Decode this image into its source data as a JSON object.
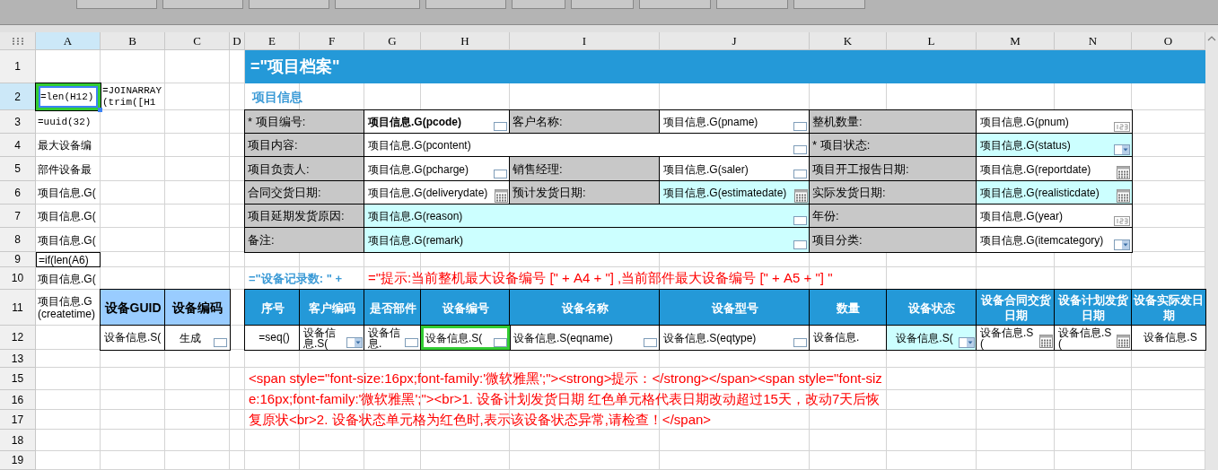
{
  "column_headers": [
    {
      "label": "A",
      "selected": true
    },
    {
      "label": "B",
      "selected": false
    },
    {
      "label": "C",
      "selected": false
    },
    {
      "label": "D",
      "selected": false
    },
    {
      "label": "E",
      "selected": false
    },
    {
      "label": "F",
      "selected": false
    },
    {
      "label": "G",
      "selected": false
    },
    {
      "label": "H",
      "selected": false
    },
    {
      "label": "I",
      "selected": false
    },
    {
      "label": "J",
      "selected": false
    },
    {
      "label": "K",
      "selected": false
    },
    {
      "label": "L",
      "selected": false
    },
    {
      "label": "M",
      "selected": false
    },
    {
      "label": "N",
      "selected": false
    },
    {
      "label": "O",
      "selected": false
    }
  ],
  "row_headers": [
    {
      "label": "1",
      "selected": false
    },
    {
      "label": "2",
      "selected": true
    },
    {
      "label": "3",
      "selected": false
    },
    {
      "label": "4",
      "selected": false
    },
    {
      "label": "5",
      "selected": false
    },
    {
      "label": "6",
      "selected": false
    },
    {
      "label": "7",
      "selected": false
    },
    {
      "label": "8",
      "selected": false
    },
    {
      "label": "9",
      "selected": false
    },
    {
      "label": "10",
      "selected": false
    },
    {
      "label": "11",
      "selected": false
    },
    {
      "label": "12",
      "selected": false
    },
    {
      "label": "13",
      "selected": false
    },
    {
      "label": "15",
      "selected": false
    },
    {
      "label": "16",
      "selected": false
    },
    {
      "label": "17",
      "selected": false
    },
    {
      "label": "18",
      "selected": false
    },
    {
      "label": "19",
      "selected": false
    }
  ],
  "cells": [
    {
      "kind": "title",
      "text": "=\"项目档案\""
    },
    {
      "kind": "formula",
      "text": "=len(H12)",
      "selected": true
    },
    {
      "kind": "formula",
      "text": "=JOINARRAY(trim([H1"
    },
    {
      "kind": "section",
      "text": "项目信息"
    },
    {
      "kind": "formula",
      "text": "=uuid(32)"
    },
    {
      "kind": "text",
      "text": "最大设备编"
    },
    {
      "kind": "text",
      "text": "部件设备最"
    },
    {
      "kind": "text",
      "text": "项目信息.G("
    },
    {
      "kind": "text",
      "text": "项目信息.G("
    },
    {
      "kind": "text",
      "text": "项目信息.G("
    },
    {
      "kind": "boxed",
      "text": "=if(len(A6)"
    },
    {
      "kind": "text",
      "text": "项目信息.G("
    },
    {
      "kind": "text",
      "text": "项目信息.G(createtime)"
    },
    {
      "kind": "label",
      "text": "* 项目编号:"
    },
    {
      "kind": "value",
      "text": "项目信息.G(pcode)",
      "bold": true,
      "highlight": false,
      "widget": {
        "kind": "textbox"
      }
    },
    {
      "kind": "label",
      "text": "客户名称:"
    },
    {
      "kind": "value",
      "text": "项目信息.G(pname)",
      "highlight": false,
      "widget": {
        "kind": "textbox"
      }
    },
    {
      "kind": "label",
      "text": "整机数量:"
    },
    {
      "kind": "value",
      "text": "项目信息.G(pnum)",
      "highlight": false,
      "widget": {
        "kind": "number"
      }
    },
    {
      "kind": "label",
      "text": "项目内容:"
    },
    {
      "kind": "value",
      "text": "项目信息.G(pcontent)",
      "highlight": false,
      "widget": {
        "kind": "textbox"
      }
    },
    {
      "kind": "label",
      "text": "* 项目状态:"
    },
    {
      "kind": "value",
      "text": "项目信息.G(status)",
      "highlight": true,
      "widget": {
        "kind": "combo"
      }
    },
    {
      "kind": "label",
      "text": "项目负责人:"
    },
    {
      "kind": "value",
      "text": "项目信息.G(pcharge)",
      "highlight": false,
      "widget": {
        "kind": "textbox"
      }
    },
    {
      "kind": "label",
      "text": "销售经理:"
    },
    {
      "kind": "value",
      "text": "项目信息.G(saler)",
      "highlight": false,
      "widget": {
        "kind": "textbox"
      }
    },
    {
      "kind": "label",
      "text": "项目开工报告日期:"
    },
    {
      "kind": "value",
      "text": "项目信息.G(reportdate)",
      "highlight": false,
      "widget": {
        "kind": "date"
      }
    },
    {
      "kind": "label",
      "text": "合同交货日期:"
    },
    {
      "kind": "value",
      "text": "项目信息.G(deliverydate)",
      "highlight": false,
      "widget": {
        "kind": "date"
      }
    },
    {
      "kind": "label",
      "text": "预计发货日期:"
    },
    {
      "kind": "value",
      "text": "项目信息.G(estimatedate)",
      "highlight": true,
      "widget": {
        "kind": "date"
      }
    },
    {
      "kind": "label",
      "text": "实际发货日期:"
    },
    {
      "kind": "value",
      "text": "项目信息.G(realisticdate)",
      "highlight": true,
      "widget": {
        "kind": "date"
      }
    },
    {
      "kind": "label",
      "text": "项目延期发货原因:"
    },
    {
      "kind": "value",
      "text": "项目信息.G(reason)",
      "highlight": true,
      "widget": {
        "kind": "textbox"
      }
    },
    {
      "kind": "label",
      "text": "年份:"
    },
    {
      "kind": "value",
      "text": "项目信息.G(year)",
      "highlight": false,
      "widget": {
        "kind": "number"
      }
    },
    {
      "kind": "label",
      "text": "备注:"
    },
    {
      "kind": "value",
      "text": "项目信息.G(remark)",
      "highlight": true,
      "widget": {
        "kind": "textbox"
      }
    },
    {
      "kind": "label",
      "text": "项目分类:"
    },
    {
      "kind": "value",
      "text": "项目信息.G(itemcategory)",
      "highlight": false,
      "widget": {
        "kind": "combo"
      }
    },
    {
      "kind": "count",
      "text": "=\"设备记录数: \" +"
    },
    {
      "kind": "hint",
      "text": "=\"提示:当前整机最大设备编号 [\" + A4 + \"] ,当前部件最大设备编号 [\" + A5 + \"] \""
    },
    {
      "kind": "subheader",
      "text": "设备GUID"
    },
    {
      "kind": "subheader",
      "text": "设备编码"
    },
    {
      "kind": "header",
      "text": "序号"
    },
    {
      "kind": "header",
      "text": "客户编码"
    },
    {
      "kind": "header",
      "text": "是否部件"
    },
    {
      "kind": "header",
      "text": "设备编号"
    },
    {
      "kind": "header",
      "text": "设备名称"
    },
    {
      "kind": "header",
      "text": "设备型号"
    },
    {
      "kind": "header",
      "text": "数量"
    },
    {
      "kind": "header",
      "text": "设备状态"
    },
    {
      "kind": "header",
      "text": "设备合同交货日期"
    },
    {
      "kind": "header",
      "text": "设备计划发货日期"
    },
    {
      "kind": "header",
      "text": "设备实际发日期"
    },
    {
      "kind": "value",
      "text": "设备信息.S(",
      "highlight": false
    },
    {
      "kind": "value",
      "text": "生成",
      "highlight": false,
      "centered": true,
      "widget": {
        "kind": "textbox"
      }
    },
    {
      "kind": "value",
      "text": "=seq()",
      "highlight": false,
      "centered": true
    },
    {
      "kind": "value",
      "text": "设备信息.S(",
      "highlight": false,
      "widget": {
        "kind": "combo"
      }
    },
    {
      "kind": "value",
      "text": "设备信息.",
      "highlight": false,
      "widget": {
        "kind": "textbox"
      }
    },
    {
      "kind": "value",
      "text": "设备信息.S(",
      "highlight": false,
      "widget": {
        "kind": "textbox"
      }
    },
    {
      "kind": "value",
      "text": "设备信息.S(eqname)",
      "highlight": false,
      "widget": {
        "kind": "textbox"
      }
    },
    {
      "kind": "value",
      "text": "设备信息.S(eqtype)",
      "highlight": false,
      "widget": {
        "kind": "textbox"
      }
    },
    {
      "kind": "value",
      "text": "设备信息.",
      "highlight": false
    },
    {
      "kind": "value",
      "text": "设备信息.S(",
      "highlight": true,
      "centered": true,
      "widget": {
        "kind": "combo"
      }
    },
    {
      "kind": "value",
      "text": "设备信息.S(",
      "highlight": false,
      "widget": {
        "kind": "date"
      }
    },
    {
      "kind": "value",
      "text": "设备信息.S(",
      "highlight": false,
      "widget": {
        "kind": "date"
      }
    },
    {
      "kind": "value",
      "text": "设备信息.S",
      "highlight": false,
      "centered": true
    },
    {
      "kind": "note",
      "text": "<span style=\"font-size:16px;font-family:'微软雅黑';\"><strong>提示：</strong></span><span style=\"font-size:16px;font-family:'微软雅黑';\"><br>1. 设备计划发货日期 红色单元格代表日期改动超过15天，改动7天后恢复原状<br>2. 设备状态单元格为红色时,表示该设备状态异常,请检查！</span>"
    }
  ]
}
